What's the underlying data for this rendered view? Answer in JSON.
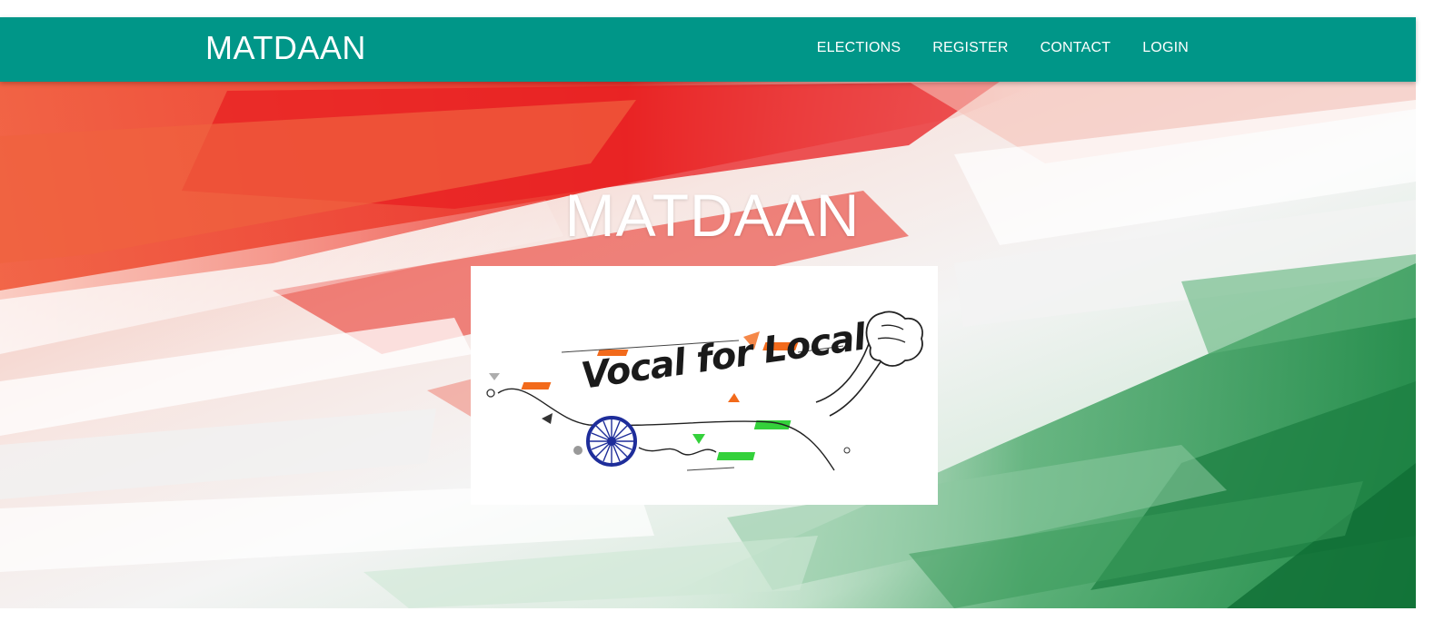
{
  "navbar": {
    "brand": "MATDAAN",
    "links": [
      {
        "label": "ELECTIONS"
      },
      {
        "label": "REGISTER"
      },
      {
        "label": "CONTACT"
      },
      {
        "label": "LOGIN"
      }
    ],
    "background_color": "#009688"
  },
  "hero": {
    "title": "MATDAAN",
    "poster_text": "Vocal for Local",
    "colors": {
      "saffron": "#e8402e",
      "white": "#ffffff",
      "green": "#2e8b57"
    }
  }
}
